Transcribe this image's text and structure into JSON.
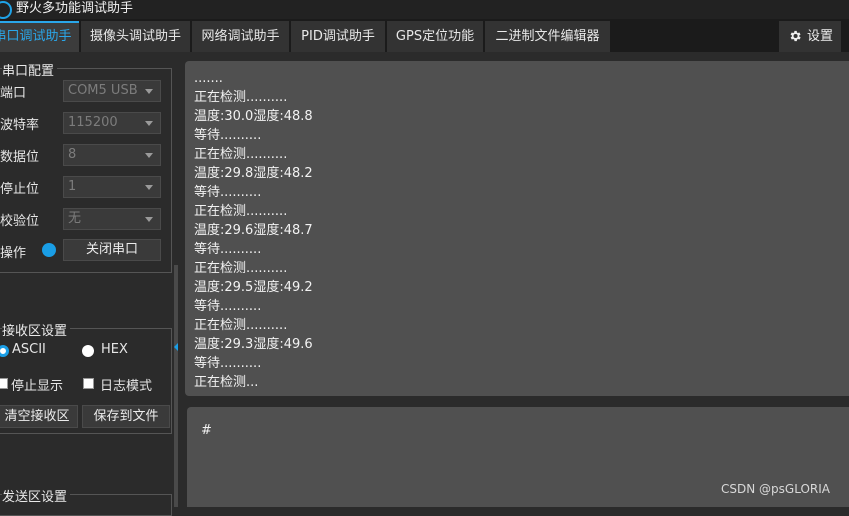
{
  "window": {
    "title": "野火多功能调试助手"
  },
  "tabs": [
    {
      "label": "串口调试助手"
    },
    {
      "label": "摄像头调试助手"
    },
    {
      "label": "网络调试助手"
    },
    {
      "label": "PID调试助手"
    },
    {
      "label": "GPS定位功能"
    },
    {
      "label": "二进制文件编辑器"
    }
  ],
  "settings": {
    "label": "设置",
    "icon": "gear-icon"
  },
  "serial_config": {
    "title": "串口配置",
    "port": {
      "label": "端口",
      "value": "COM5 USB"
    },
    "baud": {
      "label": "波特率",
      "value": "115200"
    },
    "databits": {
      "label": "数据位",
      "value": "8"
    },
    "stopbits": {
      "label": "停止位",
      "value": "1"
    },
    "parity": {
      "label": "校验位",
      "value": "无"
    },
    "operation": {
      "label": "操作",
      "button": "关闭串口",
      "led_color": "#1a9ee6"
    }
  },
  "recv_settings": {
    "title": "接收区设置",
    "ascii": "ASCII",
    "hex": "HEX",
    "stop_display": "停止显示",
    "log_mode": "日志模式",
    "clear": "清空接收区",
    "save": "保存到文件"
  },
  "send_settings": {
    "title": "发送区设置"
  },
  "receive": {
    "lines": [
      ".......",
      "正在检测..........",
      "温度:30.0湿度:48.8",
      "等待..........",
      "正在检测..........",
      "温度:29.8湿度:48.2",
      "等待..........",
      "正在检测..........",
      "温度:29.6湿度:48.7",
      "等待..........",
      "正在检测..........",
      "温度:29.5湿度:49.2",
      "等待..........",
      "正在检测..........",
      "温度:29.3湿度:49.6",
      "等待..........",
      "正在检测..."
    ]
  },
  "send": {
    "text": "#"
  },
  "watermark": "CSDN @psGLORIA",
  "colors": {
    "accent": "#1a9ee6",
    "background": "#2b2b2b",
    "text_area": "#505050"
  }
}
